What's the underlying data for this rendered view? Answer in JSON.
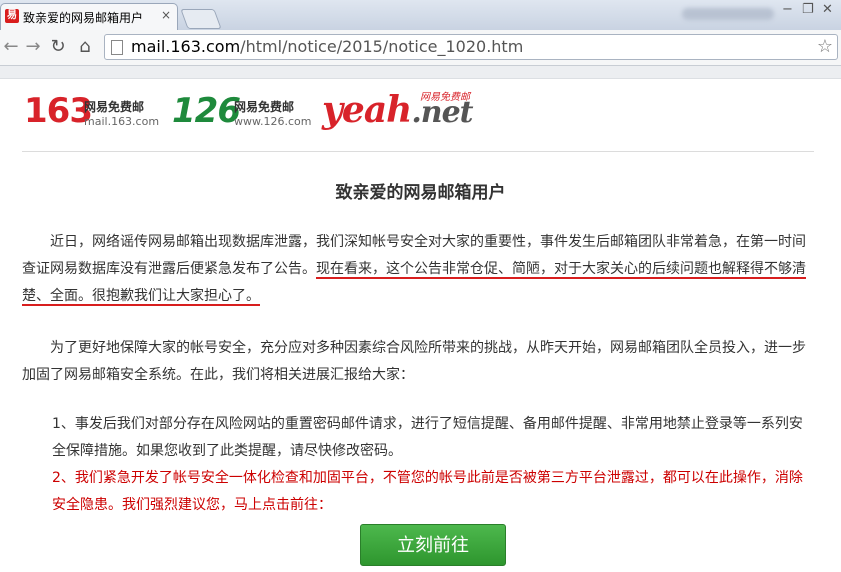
{
  "browser": {
    "tab_icon_text": "易",
    "tab_title": "致亲爱的网易邮箱用户",
    "tab_close": "×",
    "url_host": "mail.163.com",
    "url_path": "/html/notice/2015/notice_1020.htm",
    "nav": {
      "back": "←",
      "forward": "→",
      "reload": "↻",
      "home": "⌂",
      "star": "☆"
    },
    "window": {
      "minimize": "−",
      "restore": "❐",
      "close": "✕"
    }
  },
  "logos": {
    "l163": {
      "num": "163",
      "cn": "网易免费邮",
      "domain": "mail.163.com",
      "color": "#d8232a"
    },
    "l126": {
      "num": "126",
      "cn": "网易免费邮",
      "domain": "www.126.com",
      "color": "#1e8a3c"
    },
    "yeah": {
      "word": "yeah",
      "dot": ".net",
      "cn": "网易免费邮"
    }
  },
  "notice": {
    "title": "致亲爱的网易邮箱用户",
    "p1_a": "近日，网络谣传网易邮箱出现数据库泄露，我们深知帐号安全对大家的重要性，事件发生后邮箱团队非常着急，在第一时间查证网易数据库没有泄露后便紧急发布了公告。",
    "p1_b": "现在看来，这个公告非常仓促、简陋，对于大家关心的后续问题也解释得不够清楚、全面。很抱歉我们让大家担心了。",
    "p2": "为了更好地保障大家的帐号安全，充分应对多种因素综合风险所带来的挑战，从昨天开始，网易邮箱团队全员投入，进一步加固了网易邮箱安全系统。在此，我们将相关进展汇报给大家：",
    "item1": "1、事发后我们对部分存在风险网站的重置密码邮件请求，进行了短信提醒、备用邮件提醒、非常用地禁止登录等一系列安全保障措施。如果您收到了此类提醒，请尽快修改密码。",
    "item2": "2、我们紧急开发了帐号安全一体化检查和加固平台，不管您的帐号此前是否被第三方平台泄露过，都可以在此操作，消除安全隐患。我们强烈建议您，马上点击前往：",
    "cta": "立刻前往",
    "accent_red": "#c00000",
    "cta_color": "#3aa63a"
  }
}
